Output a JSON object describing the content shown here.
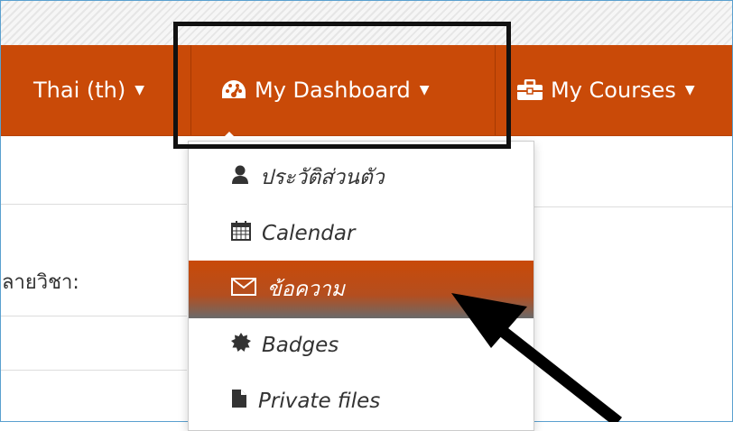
{
  "navbar": {
    "language_label": "Thai (th)",
    "dashboard_label": "My Dashboard",
    "courses_label": "My Courses",
    "bg_color": "#c94a08"
  },
  "dropdown": {
    "items": [
      {
        "label": "ประวัติส่วนตัว",
        "icon": "user-icon"
      },
      {
        "label": "Calendar",
        "icon": "calendar-icon"
      },
      {
        "label": "ข้อความ",
        "icon": "envelope-icon",
        "active": true
      },
      {
        "label": "Badges",
        "icon": "badge-icon"
      },
      {
        "label": "Private files",
        "icon": "file-icon"
      }
    ]
  },
  "page": {
    "course_label": "ลายวิชา:"
  }
}
